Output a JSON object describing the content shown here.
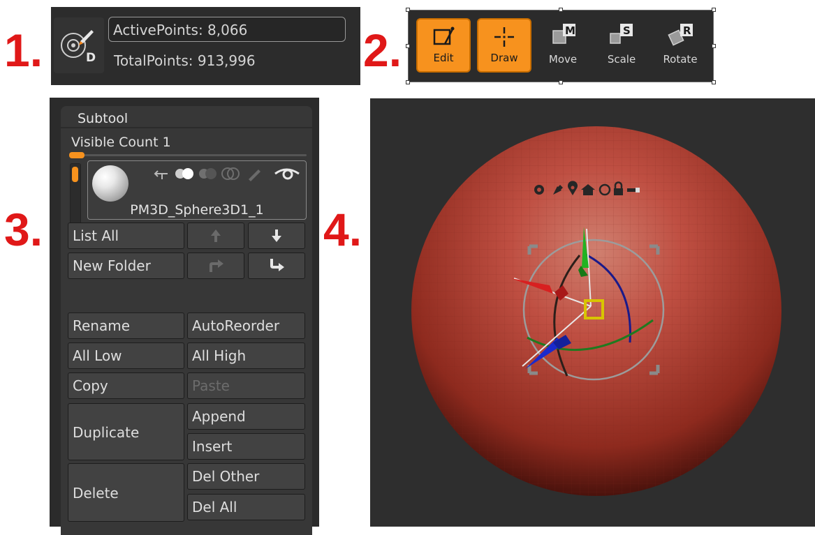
{
  "labels": [
    "1.",
    "2.",
    "3.",
    "4."
  ],
  "points": {
    "active": "ActivePoints: 8,066",
    "total": "TotalPoints: 913,996",
    "icon_letter": "D"
  },
  "toolbar": {
    "buttons": [
      {
        "label": "Edit",
        "state": "active",
        "icon": "edit-icon"
      },
      {
        "label": "Draw",
        "state": "active",
        "icon": "draw-icon"
      },
      {
        "label": "Move",
        "state": "inactive",
        "icon": "move-icon",
        "badge": "M"
      },
      {
        "label": "Scale",
        "state": "inactive",
        "icon": "scale-icon",
        "badge": "S"
      },
      {
        "label": "Rotate",
        "state": "inactive",
        "icon": "rotate-icon",
        "badge": "R"
      }
    ],
    "accent": "#f7921e"
  },
  "subtool": {
    "title": "Subtool",
    "visible_count": "Visible Count 1",
    "item_name": "PM3D_Sphere3D1_1",
    "buttons": {
      "list_all": "List All",
      "new_folder": "New Folder",
      "rename": "Rename",
      "auto_reorder": "AutoReorder",
      "all_low": "All Low",
      "all_high": "All High",
      "copy": "Copy",
      "paste": "Paste",
      "duplicate": "Duplicate",
      "append": "Append",
      "insert": "Insert",
      "delete": "Delete",
      "del_other": "Del Other",
      "del_all": "Del All"
    }
  },
  "viewport": {
    "sphere_color": "#b8473a",
    "gizmo_icons": [
      "gear-icon",
      "pin-icon",
      "location-icon",
      "home-icon",
      "reset-icon",
      "lock-icon",
      "slider-icon"
    ]
  }
}
